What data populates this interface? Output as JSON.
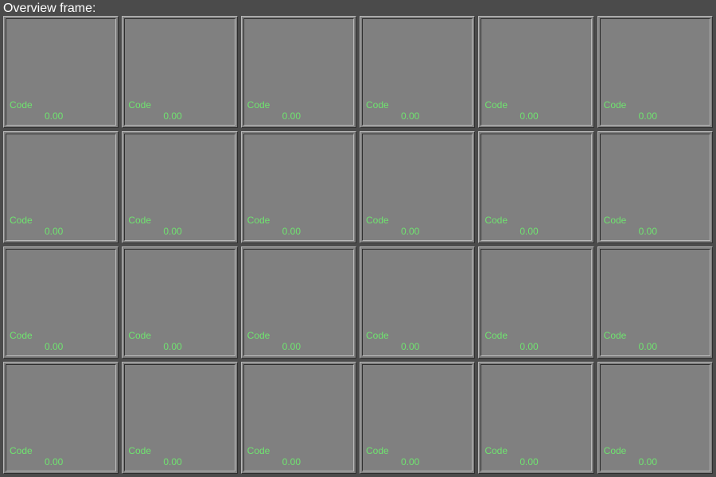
{
  "title": "Overview frame:",
  "cell_label": "Code",
  "cells": [
    {
      "value": "0.00"
    },
    {
      "value": "0.00"
    },
    {
      "value": "0.00"
    },
    {
      "value": "0.00"
    },
    {
      "value": "0.00"
    },
    {
      "value": "0.00"
    },
    {
      "value": "0.00"
    },
    {
      "value": "0.00"
    },
    {
      "value": "0.00"
    },
    {
      "value": "0.00"
    },
    {
      "value": "0.00"
    },
    {
      "value": "0.00"
    },
    {
      "value": "0.00"
    },
    {
      "value": "0.00"
    },
    {
      "value": "0.00"
    },
    {
      "value": "0.00"
    },
    {
      "value": "0.00"
    },
    {
      "value": "0.00"
    },
    {
      "value": "0.00"
    },
    {
      "value": "0.00"
    },
    {
      "value": "0.00"
    },
    {
      "value": "0.00"
    },
    {
      "value": "0.00"
    },
    {
      "value": "0.00"
    }
  ]
}
